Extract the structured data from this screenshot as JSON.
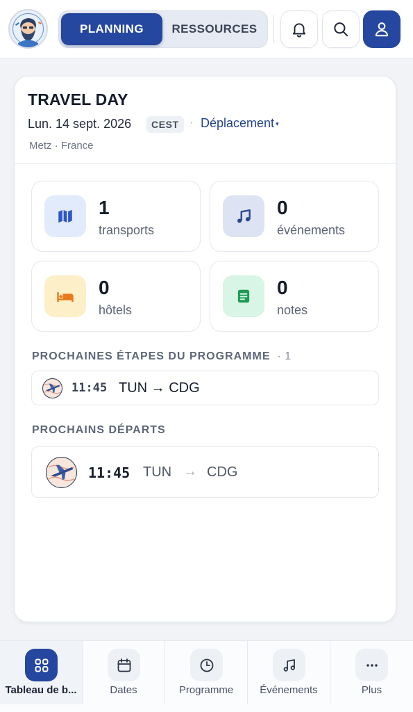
{
  "header": {
    "tabs": [
      {
        "label": "PLANNING",
        "active": true
      },
      {
        "label": "RESSOURCES",
        "active": false
      }
    ],
    "icons": [
      "bell-icon",
      "search-icon",
      "user-icon"
    ]
  },
  "day": {
    "title": "TRAVEL DAY",
    "date": "Lun. 14 sept. 2026",
    "timezone": "CEST",
    "separator": "·",
    "mode": "Déplacement",
    "location": "Metz · France"
  },
  "stats": [
    {
      "count": "1",
      "label": "transports",
      "icon": "map-icon"
    },
    {
      "count": "0",
      "label": "événements",
      "icon": "music-icon"
    },
    {
      "count": "0",
      "label": "hôtels",
      "icon": "bed-icon"
    },
    {
      "count": "0",
      "label": "notes",
      "icon": "note-icon"
    }
  ],
  "upcoming": {
    "heading": "PROCHAINES ÉTAPES DU PROGRAMME",
    "count": "· 1",
    "items": [
      {
        "time": "11:45",
        "route": "TUN → CDG"
      }
    ]
  },
  "departures": {
    "heading": "PROCHAINS DÉPARTS",
    "items": [
      {
        "time": "11:45",
        "from": "TUN",
        "arrow": "→",
        "to": "CDG"
      }
    ]
  },
  "nav": [
    {
      "label": "Tableau de b...",
      "icon": "dashboard-icon",
      "active": true
    },
    {
      "label": "Dates",
      "icon": "calendar-icon",
      "active": false
    },
    {
      "label": "Programme",
      "icon": "clock-icon",
      "active": false
    },
    {
      "label": "Événements",
      "icon": "music-icon",
      "active": false
    },
    {
      "label": "Plus",
      "icon": "more-icon",
      "active": false
    }
  ],
  "colors": {
    "primary": "#25479f",
    "transport_bg": "#e1ebfb",
    "event_bg": "#dde3f2",
    "hotel_bg": "#fdefc7",
    "note_bg": "#d9f5e5"
  }
}
